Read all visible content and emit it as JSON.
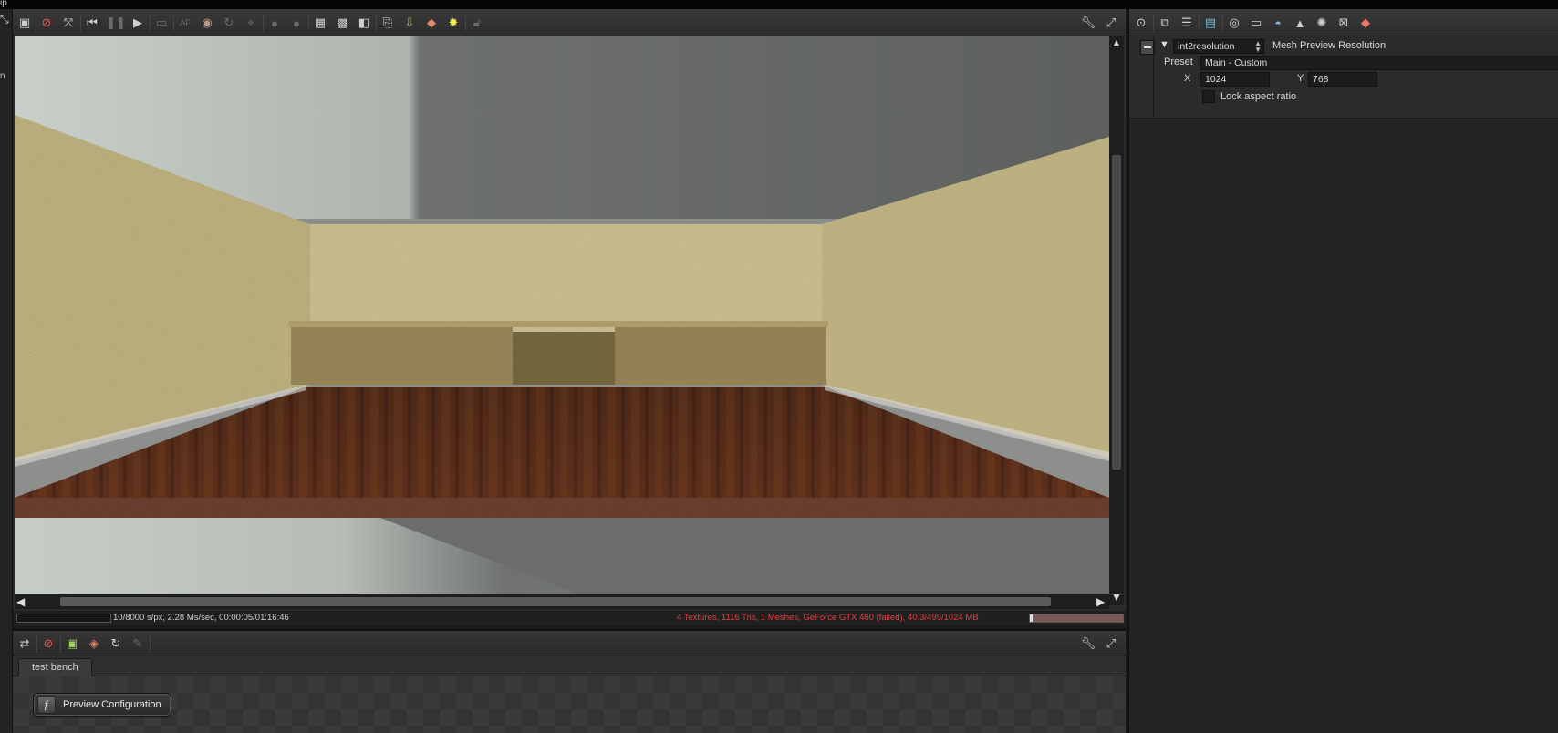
{
  "left_stub": {
    "top": "ip",
    "mid": "n"
  },
  "viewport": {
    "toolbar_icons": [
      "render-icon",
      "stop-icon",
      "zoom-icon",
      "rewind-icon",
      "pause-icon",
      "play-icon",
      "monitor-icon",
      "af-icon",
      "color-icon",
      "reload-icon",
      "focus-icon",
      "sphere-icon",
      "sphere2-icon",
      "grid-icon",
      "checker-icon",
      "alpha-icon",
      "copy-icon",
      "save-icon",
      "export-icon",
      "light-icon",
      "lock-icon"
    ],
    "status_left": "10/8000 s/px, 2.28 Ms/sec, 00:00:05/01:16:46",
    "status_right": "4 Textures, 1116 Tris, 1 Meshes, GeForce GTX 460 (failed), 40.3/499/1024 MB",
    "memory_fraction": 0.04
  },
  "graph": {
    "tab_label": "test bench",
    "node_label": "Preview Configuration"
  },
  "inspector": {
    "node_type": "int2resolution",
    "node_title": "Mesh Preview Resolution",
    "preset_label": "Preset",
    "preset_value": "Main - Custom",
    "x_label": "X",
    "x_value": "1024",
    "y_label": "Y",
    "y_value": "768",
    "lock_label": "Lock aspect ratio"
  },
  "colors": {
    "status_error": "#e04040",
    "panel_bg": "#2b2b2b",
    "wall": "#c9bd8c",
    "floor": "#5a2e18"
  }
}
